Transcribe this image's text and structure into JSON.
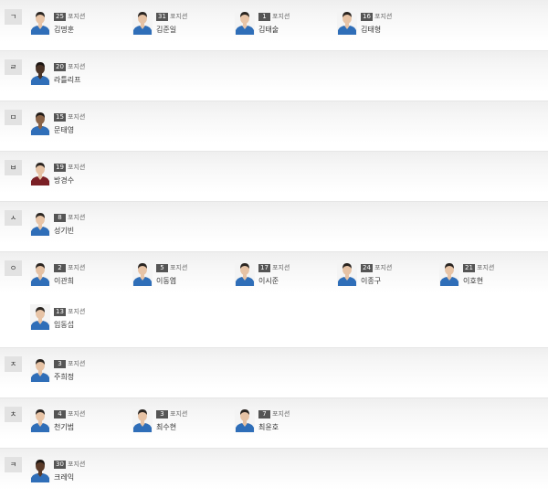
{
  "position_label": "포지션",
  "groups": [
    {
      "letter": "ㄱ",
      "players": [
        {
          "number": "25",
          "name": "김명훈",
          "skin": "#e8c4a6",
          "hair": "#2a2522"
        },
        {
          "number": "31",
          "name": "김준일",
          "skin": "#e6c2a4",
          "hair": "#2b2622"
        },
        {
          "number": "1",
          "name": "김태술",
          "skin": "#e9c5a7",
          "hair": "#2a2520"
        },
        {
          "number": "16",
          "name": "김태형",
          "skin": "#e7c3a5",
          "hair": "#2a2420"
        }
      ]
    },
    {
      "letter": "ㄹ",
      "players": [
        {
          "number": "20",
          "name": "라틀리프",
          "skin": "#4a3326",
          "hair": "#1c1512"
        }
      ]
    },
    {
      "letter": "ㅁ",
      "players": [
        {
          "number": "15",
          "name": "문태영",
          "skin": "#8a6347",
          "hair": "#1f1915"
        }
      ]
    },
    {
      "letter": "ㅂ",
      "players": [
        {
          "number": "19",
          "name": "방경수",
          "skin": "#e6c2a4",
          "hair": "#2a2420",
          "jersey": "#7a1f25"
        }
      ]
    },
    {
      "letter": "ㅅ",
      "players": [
        {
          "number": "8",
          "name": "성기빈",
          "skin": "#e8c4a6",
          "hair": "#2b2622"
        }
      ]
    },
    {
      "letter": "ㅇ",
      "players": [
        {
          "number": "2",
          "name": "이관희",
          "skin": "#e5c1a3",
          "hair": "#2a2420"
        },
        {
          "number": "5",
          "name": "이동엽",
          "skin": "#e8c4a6",
          "hair": "#2a2522"
        },
        {
          "number": "17",
          "name": "이시준",
          "skin": "#e7c3a5",
          "hair": "#2b2622"
        },
        {
          "number": "24",
          "name": "이종구",
          "skin": "#e6c2a4",
          "hair": "#2a2420"
        },
        {
          "number": "21",
          "name": "이호현",
          "skin": "#e8c4a6",
          "hair": "#2a2522"
        },
        {
          "number": "13",
          "name": "임동섭",
          "skin": "#e7c3a5",
          "hair": "#2b2622"
        }
      ]
    },
    {
      "letter": "ㅈ",
      "players": [
        {
          "number": "3",
          "name": "주희정",
          "skin": "#e6c2a4",
          "hair": "#2a2420"
        }
      ]
    },
    {
      "letter": "ㅊ",
      "players": [
        {
          "number": "4",
          "name": "천기범",
          "skin": "#e8c4a6",
          "hair": "#2a2522"
        },
        {
          "number": "3",
          "name": "최수현",
          "skin": "#e7c3a5",
          "hair": "#2b2622"
        },
        {
          "number": "7",
          "name": "최윤호",
          "skin": "#e6c2a4",
          "hair": "#2a2420"
        }
      ]
    },
    {
      "letter": "ㅋ",
      "players": [
        {
          "number": "30",
          "name": "크레익",
          "skin": "#5a3a28",
          "hair": "#1a1410"
        }
      ]
    }
  ],
  "colors": {
    "jersey": "#2f6eb8",
    "badge": "#555555",
    "letter_box": "#e2e2e2"
  }
}
